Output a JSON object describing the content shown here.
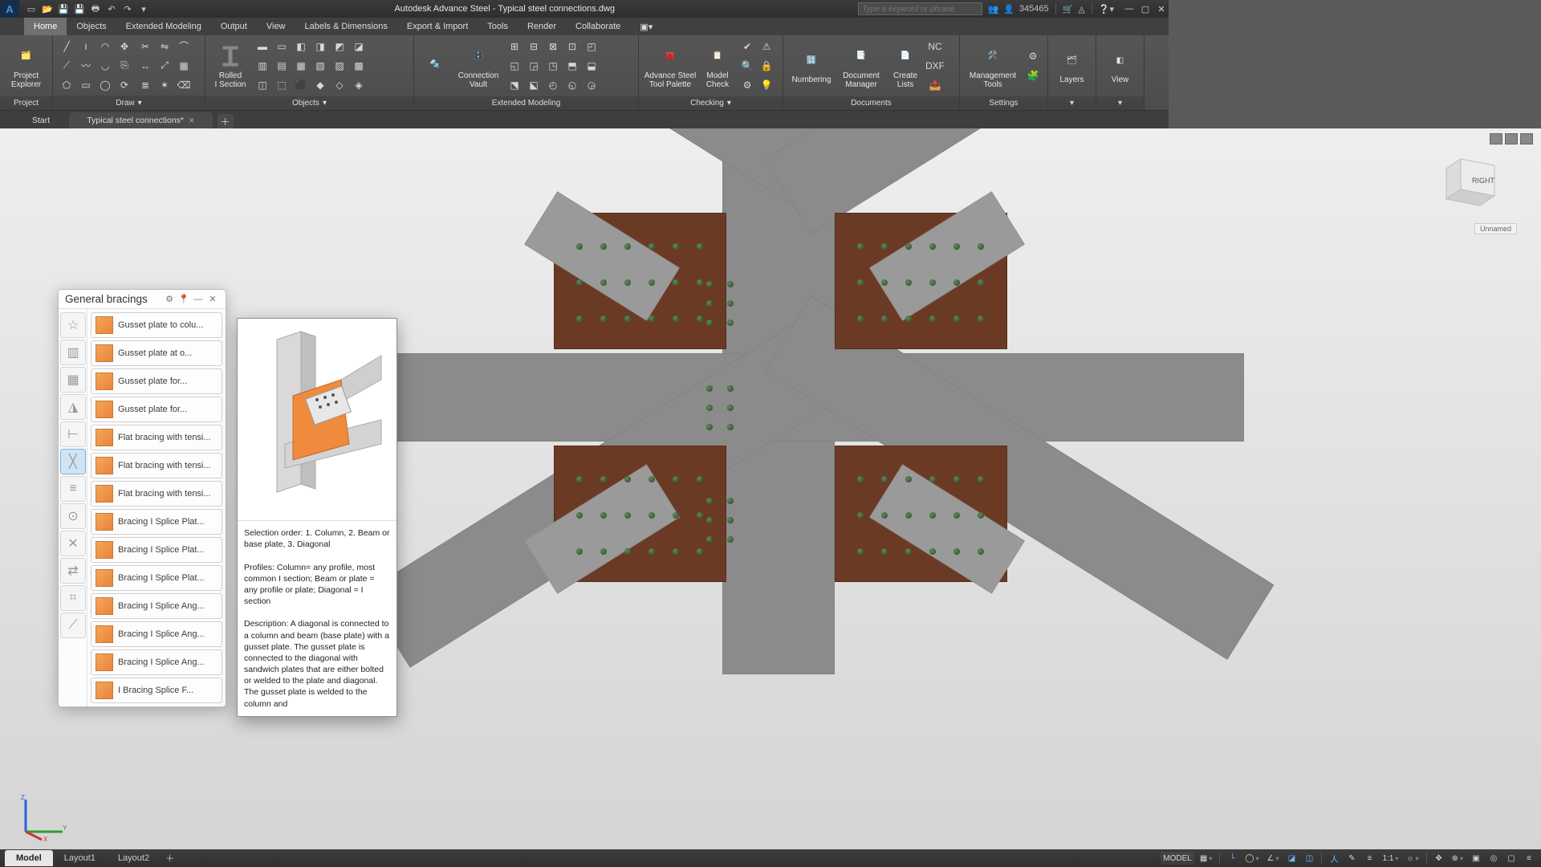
{
  "title_bar": {
    "app": "Autodesk Advance Steel",
    "file": "Typical steel connections.dwg",
    "search_placeholder": "Type a keyword or phrase",
    "user": "345465"
  },
  "ribbon_tabs": [
    "Home",
    "Objects",
    "Extended Modeling",
    "Output",
    "View",
    "Labels & Dimensions",
    "Export & Import",
    "Tools",
    "Render",
    "Collaborate"
  ],
  "ribbon": {
    "project": {
      "explorer_btn": "Project\nExplorer",
      "label": "Project"
    },
    "draw": {
      "label": "Draw"
    },
    "objects": {
      "rolled": "Rolled\nI Section",
      "label": "Objects"
    },
    "ext": {
      "conn": "Connection\nVault",
      "label": "Extended Modeling"
    },
    "checking": {
      "tool_palette": "Advance Steel\nTool Palette",
      "model_check": "Model\nCheck",
      "label": "Checking"
    },
    "docs": {
      "numbering": "Numbering",
      "doc_mgr": "Document\nManager",
      "create_lists": "Create\nLists",
      "label": "Documents"
    },
    "settings": {
      "mgmt": "Management\nTools",
      "label": "Settings"
    },
    "layers": {
      "label": "Layers"
    },
    "view": {
      "label": "View"
    }
  },
  "doc_tabs": {
    "start": "Start",
    "file": "Typical steel connections*"
  },
  "palette": {
    "title": "General bracings",
    "items": [
      "Gusset plate to colu...",
      "Gusset plate at o...",
      "Gusset plate for...",
      "Gusset plate for...",
      "Flat bracing with tensi...",
      "Flat bracing with tensi...",
      "Flat bracing with tensi...",
      "Bracing I Splice Plat...",
      "Bracing I Splice Plat...",
      "Bracing I Splice Plat...",
      "Bracing I Splice Ang...",
      "Bracing I Splice Ang...",
      "Bracing I Splice Ang...",
      "I Bracing Splice F..."
    ]
  },
  "tooltip": {
    "p1": "Selection order: 1. Column, 2. Beam or base plate, 3. Diagonal",
    "p2": "Profiles: Column= any profile, most common I section; Beam or plate = any profile or plate; Diagonal = I section",
    "p3": "Description: A diagonal is connected to a column and beam (base plate) with a gusset plate. The gusset plate is connected to the diagonal with sandwich plates that are either bolted or welded to the plate and diagonal. The gusset plate is welded to the column and"
  },
  "viewcube": {
    "face": "RIGHT",
    "state": "Unnamed"
  },
  "layout_tabs": [
    "Model",
    "Layout1",
    "Layout2"
  ],
  "status": {
    "model_btn": "MODEL",
    "scale": "1:1"
  }
}
